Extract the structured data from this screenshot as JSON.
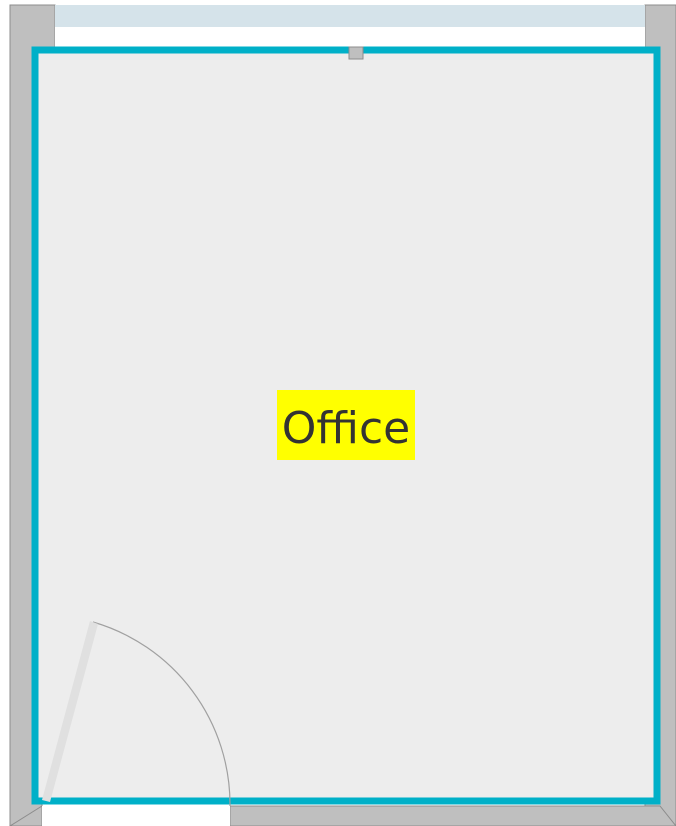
{
  "room": {
    "label": "Office",
    "floor_color": "#ededed",
    "outline_color": "#00b0c8",
    "label_highlight_color": "#ffff00",
    "label_text_color": "#333333"
  },
  "walls": {
    "color": "#bfbfbf",
    "edge_color": "#8c8c8c"
  },
  "window": {
    "glass_color": "#d5e3ea",
    "frame_color": "#ffffff"
  },
  "door": {
    "swing_color": "#a0a0a0",
    "leaf_color": "#e0e0e0"
  }
}
